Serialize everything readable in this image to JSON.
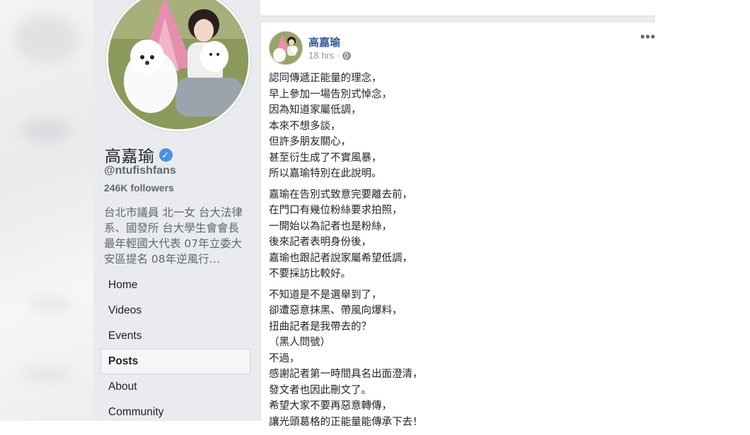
{
  "profile": {
    "name": "高嘉瑜",
    "verified_symbol": "✓",
    "handle": "@ntufishfans",
    "followers": "246K followers",
    "bio": "台北市議員 北一女 台大法律系、國發所 台大學生會會長 最年輕國大代表 07年立委大安區提名 08年逆風行…"
  },
  "nav": {
    "items": [
      {
        "label": "Home",
        "active": false
      },
      {
        "label": "Videos",
        "active": false
      },
      {
        "label": "Events",
        "active": false
      },
      {
        "label": "Posts",
        "active": true
      },
      {
        "label": "About",
        "active": false
      },
      {
        "label": "Community",
        "active": false
      }
    ]
  },
  "post": {
    "author": "高嘉瑜",
    "time": "18 hrs",
    "separator": "·",
    "more_label": "•••",
    "paragraphs": [
      [
        "認同傳遞正能量的理念，",
        "早上參加一場告別式悼念，",
        "因為知道家屬低調，",
        "本來不想多談，",
        "但許多朋友關心，",
        "甚至衍生成了不實風暴，",
        "所以嘉瑜特別在此說明。"
      ],
      [
        "嘉瑜在告別式致意完要離去前，",
        "在門口有幾位粉絲要求拍照，",
        "一開始以為記者也是粉絲，",
        "後來記者表明身份後，",
        "嘉瑜也跟記者說家屬希望低調，",
        "不要採訪比較好。"
      ],
      [
        "不知道是不是選舉到了，",
        "卻遭惡意抹黑、帶風向爆料，",
        "扭曲記者是我帶去的？",
        "（黑人問號）",
        "不過，",
        "感謝記者第一時間具名出面澄清，",
        "發文者也因此刪文了。",
        "希望大家不要再惡意轉傳，",
        "讓光頭葛格的正能量能傳承下去！"
      ]
    ]
  },
  "colors": {
    "link": "#365899",
    "sidebar_bg": "#e9ebee",
    "verified": "#4a90e2"
  }
}
